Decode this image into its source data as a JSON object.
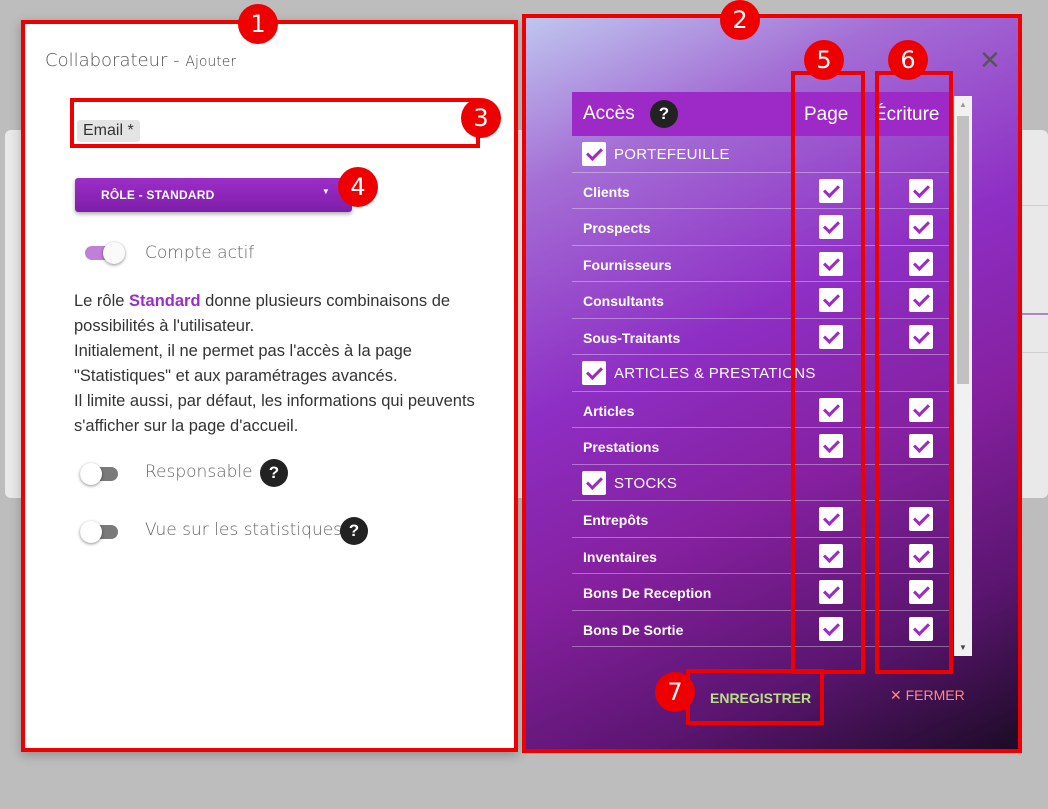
{
  "left": {
    "title": "Collaborateur",
    "title_sep": " - ",
    "title_sub": "Ajouter",
    "email_label": "Email *",
    "role_button": "RÔLE - STANDARD",
    "caret": "▼",
    "toggles": {
      "actif": "Compte actif",
      "responsable": "Responsable",
      "stats": "Vue sur les statistiques"
    },
    "desc": {
      "p1": "Le rôle ",
      "role": "Standard",
      "p2": " donne plusieurs combinaisons de possibilités à l'utilisateur.",
      "l2": "Initialement, il ne permet pas l'accès à la page \"Statistiques\" et aux paramétrages avancés.",
      "l3": "Il limite aussi, par défaut, les informations qui peuvents s'afficher sur la page d'accueil."
    },
    "help_glyph": "?"
  },
  "right": {
    "close_glyph": "✕",
    "header": {
      "acces": "Accès",
      "page": "Page",
      "ecriture": "Écriture"
    },
    "rows": [
      {
        "type": "section",
        "label": "PORTEFEUILLE"
      },
      {
        "type": "item",
        "label": "Clients"
      },
      {
        "type": "item",
        "label": "Prospects"
      },
      {
        "type": "item",
        "label": "Fournisseurs"
      },
      {
        "type": "item",
        "label": "Consultants"
      },
      {
        "type": "item",
        "label": "Sous-Traitants"
      },
      {
        "type": "section",
        "label": "ARTICLES & PRESTATIONS"
      },
      {
        "type": "item",
        "label": "Articles"
      },
      {
        "type": "item",
        "label": "Prestations"
      },
      {
        "type": "section",
        "label": "STOCKS"
      },
      {
        "type": "item",
        "label": "Entrepôts"
      },
      {
        "type": "item",
        "label": "Inventaires"
      },
      {
        "type": "item",
        "label": "Bons De Reception"
      },
      {
        "type": "item",
        "label": "Bons De Sortie"
      }
    ],
    "save": "ENREGISTRER",
    "close": "✕ FERMER"
  },
  "badges": [
    "1",
    "2",
    "3",
    "4",
    "5",
    "6",
    "7"
  ],
  "colors": {
    "highlight": "#ee0000",
    "accent": "#9d29c6",
    "save": "#b5e084",
    "close": "#ff8a8a"
  }
}
